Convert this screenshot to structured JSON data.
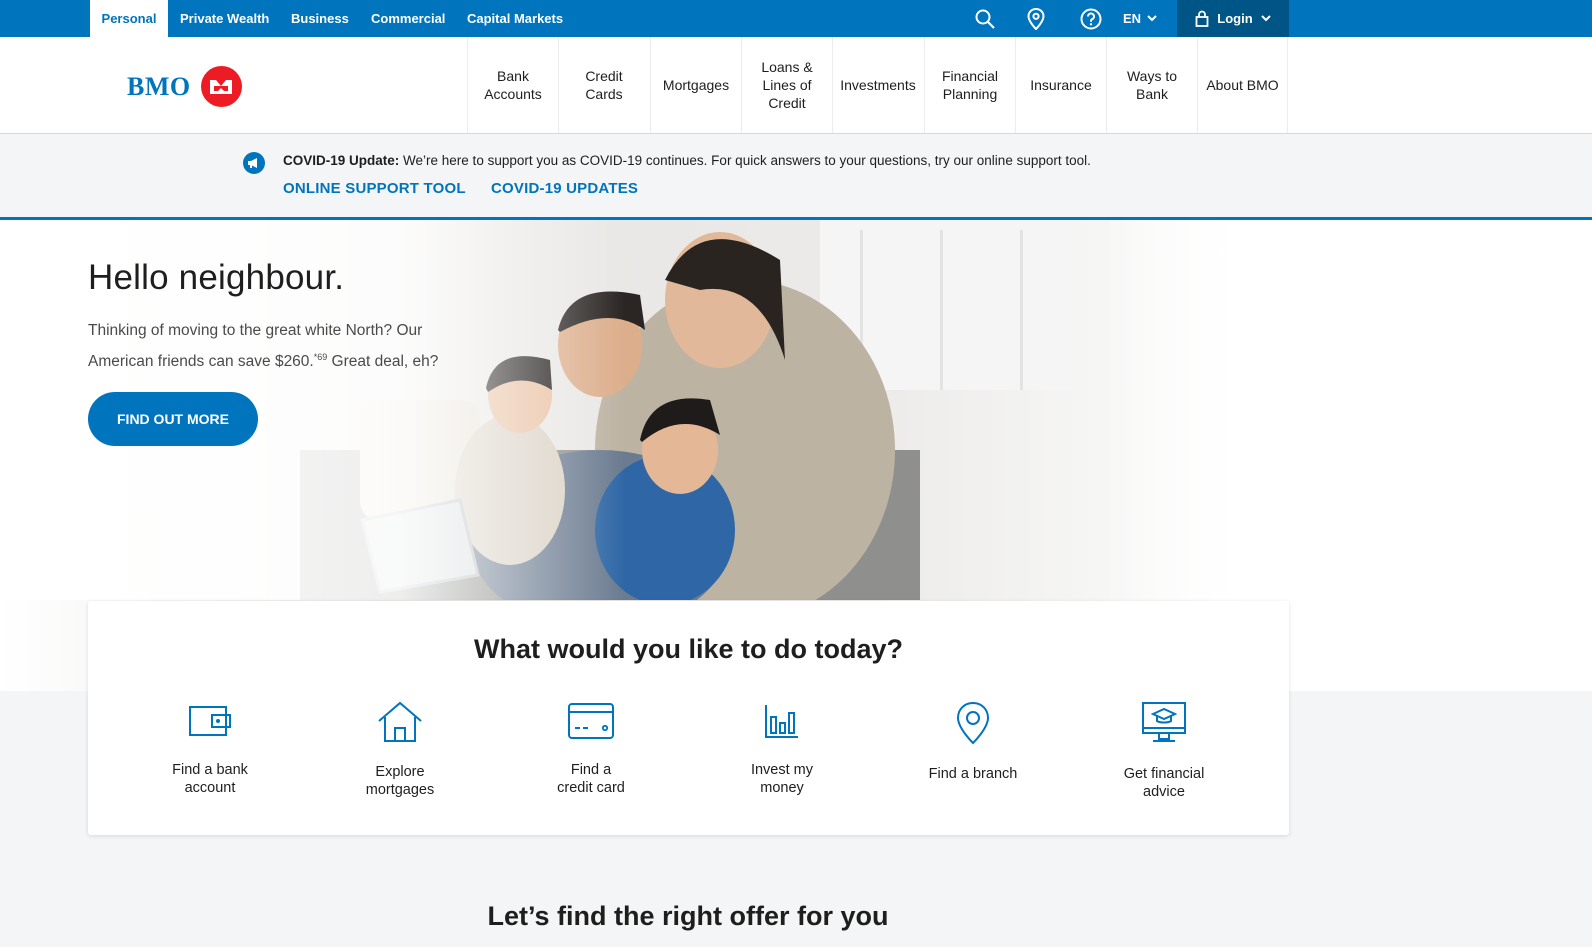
{
  "segments": [
    "Personal",
    "Private Wealth",
    "Business",
    "Commercial",
    "Capital Markets"
  ],
  "utility": {
    "language": "EN",
    "login": "Login"
  },
  "logo": {
    "text": "BMO"
  },
  "nav": [
    "Bank\nAccounts",
    "Credit\nCards",
    "Mortgages",
    "Loans &\nLines of\nCredit",
    "Investments",
    "Financial\nPlanning",
    "Insurance",
    "Ways to\nBank",
    "About BMO"
  ],
  "banner": {
    "label": "COVID-19 Update:",
    "text": " We’re here to support you as COVID-19 continues. For quick answers to your questions, try our online support tool.",
    "links": [
      "ONLINE SUPPORT TOOL",
      "COVID-19 UPDATES"
    ]
  },
  "hero": {
    "title": "Hello neighbour.",
    "line1": "Thinking of moving to the great white North? Our",
    "line2_pre": "American friends can save $260.",
    "footnote": "*69",
    "line2_post": " Great deal, eh?",
    "button": "FIND OUT MORE"
  },
  "actions": {
    "title": "What would you like to do today?",
    "items": [
      {
        "label": "Find a bank\naccount",
        "icon": "wallet-icon"
      },
      {
        "label": "Explore\nmortgages",
        "icon": "house-icon"
      },
      {
        "label": "Find a\ncredit card",
        "icon": "credit-card-icon"
      },
      {
        "label": "Invest my\nmoney",
        "icon": "bar-chart-icon"
      },
      {
        "label": "Find a branch",
        "icon": "location-pin-icon"
      },
      {
        "label": "Get financial\nadvice",
        "icon": "monitor-graduation-cap-icon"
      }
    ]
  },
  "offers": {
    "title": "Let’s find the right offer for you"
  },
  "colors": {
    "brand_blue": "#0075be",
    "dark_blue": "#005587",
    "brand_red": "#ed1c24"
  }
}
